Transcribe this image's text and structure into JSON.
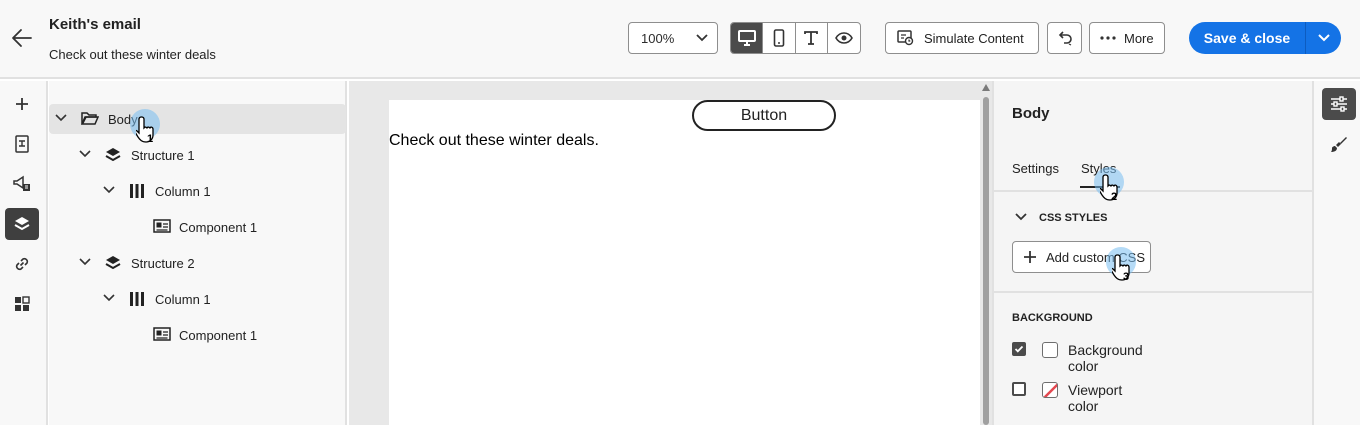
{
  "header": {
    "title": "Keith's email",
    "subtitle": "Check out these winter deals",
    "zoom": "100%",
    "simulate_label": "Simulate Content",
    "more_label": "More",
    "save_label": "Save & close"
  },
  "left_rail": {
    "icons": [
      "plus-icon",
      "fragments-icon",
      "megaphone-icon",
      "layers-icon",
      "link-icon",
      "assets-icon"
    ],
    "active": "layers-icon"
  },
  "tree": {
    "items": [
      {
        "label": "Body",
        "icon": "folder-open-icon",
        "level": 0,
        "selected": true
      },
      {
        "label": "Structure 1",
        "icon": "layers-icon",
        "level": 1
      },
      {
        "label": "Column 1",
        "icon": "columns-icon",
        "level": 2
      },
      {
        "label": "Component 1",
        "icon": "component-icon",
        "level": 3
      },
      {
        "label": "Structure 2",
        "icon": "layers-icon",
        "level": 1
      },
      {
        "label": "Column 1",
        "icon": "columns-icon",
        "level": 2
      },
      {
        "label": "Component 1",
        "icon": "component-icon",
        "level": 3
      }
    ]
  },
  "canvas": {
    "button_label": "Button",
    "body_text": "Check out these winter deals."
  },
  "properties": {
    "title": "Body",
    "tabs": [
      "Settings",
      "Styles"
    ],
    "active_tab": "Styles",
    "css_section": "CSS STYLES",
    "add_css_label": "Add custom CSS",
    "background_section": "BACKGROUND",
    "background_color_label": "Background color",
    "background_color_checked": true,
    "viewport_color_label": "Viewport color",
    "viewport_color_checked": false
  },
  "callouts": [
    "1",
    "2",
    "3"
  ],
  "colors": {
    "accent": "#1473e6",
    "active_tool": "#4b4b4b",
    "callout": "#78bef0"
  }
}
